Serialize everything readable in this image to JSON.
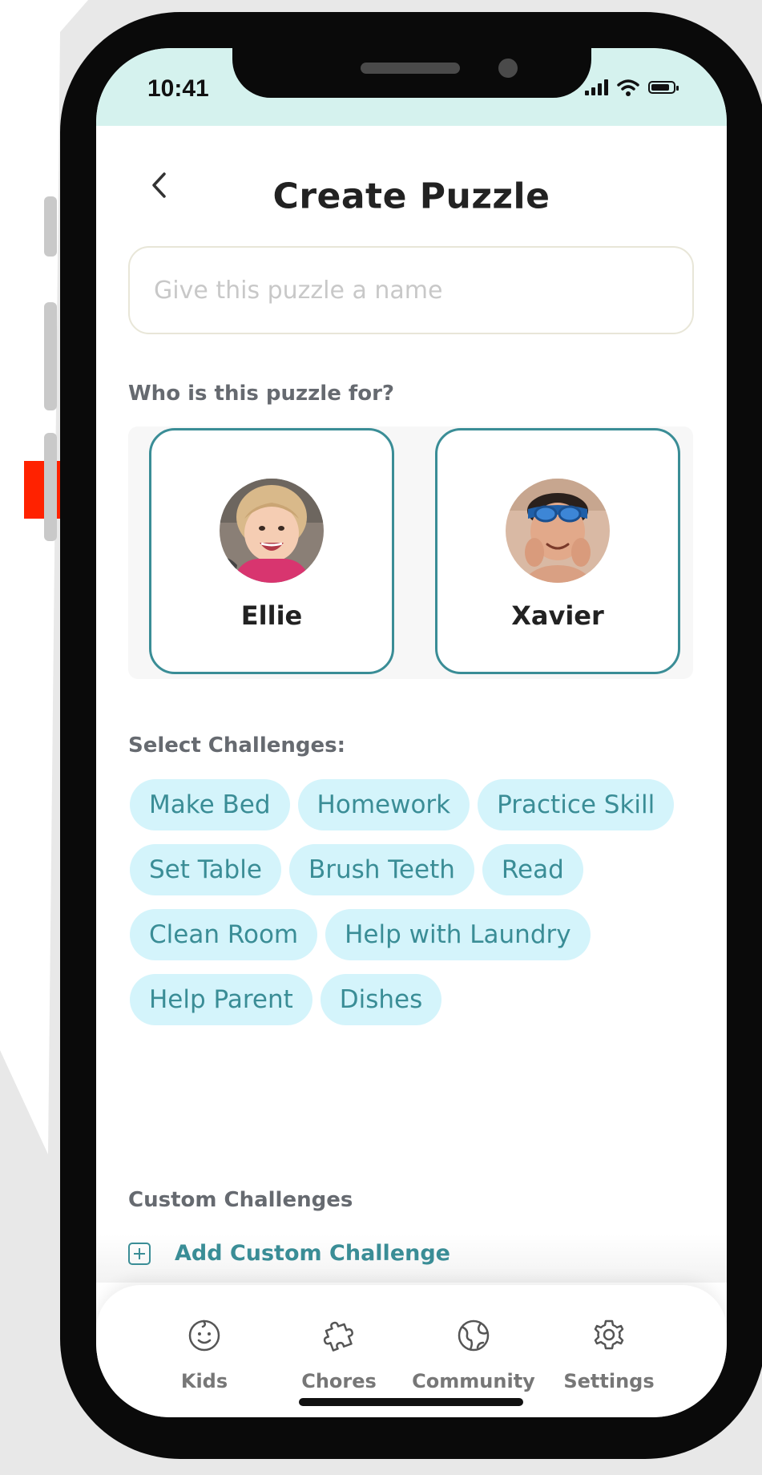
{
  "status_bar": {
    "time": "10:41"
  },
  "header": {
    "title": "Create Puzzle"
  },
  "name_input": {
    "placeholder": "Give this puzzle a name",
    "value": ""
  },
  "recipient_section": {
    "label": "Who is this puzzle for?",
    "kids": [
      {
        "name": "Ellie"
      },
      {
        "name": "Xavier"
      }
    ]
  },
  "challenges_section": {
    "label": "Select Challenges:",
    "chips": [
      "Make Bed",
      "Homework",
      "Practice Skill",
      "Set Table",
      "Brush Teeth",
      "Read",
      "Clean Room",
      "Help with Laundry",
      "Help Parent",
      "Dishes"
    ]
  },
  "custom_section": {
    "label": "Custom Challenges",
    "add_label": "Add Custom Challenge"
  },
  "tab_bar": {
    "tabs": [
      {
        "label": "Kids",
        "icon": "smiley-icon"
      },
      {
        "label": "Chores",
        "icon": "puzzle-piece-icon"
      },
      {
        "label": "Community",
        "icon": "globe-icon"
      },
      {
        "label": "Settings",
        "icon": "gear-icon"
      }
    ]
  },
  "colors": {
    "accent": "#3a8d96",
    "chip_background": "#d4f4fb",
    "status_bar_background": "#d5f2ee",
    "annotation_arrow": "#ff2200"
  }
}
